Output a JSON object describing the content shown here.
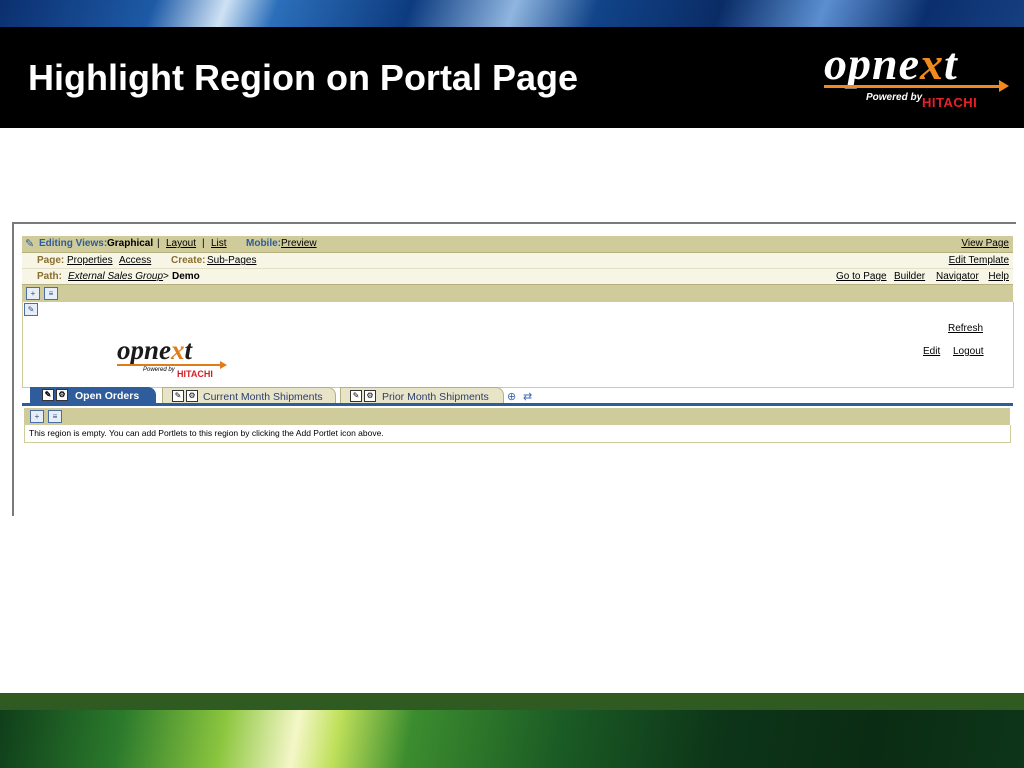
{
  "slide": {
    "title": "Highlight Region on Portal Page",
    "logo": {
      "word_a": "opne",
      "word_x": "x",
      "word_b": "t",
      "powered_by": "Powered by",
      "brand": "HITACHI"
    }
  },
  "portal": {
    "editing_views": {
      "label": "Editing Views:",
      "current": "Graphical",
      "layout": "Layout",
      "list": "List"
    },
    "mobile": {
      "label": "Mobile:",
      "preview": "Preview"
    },
    "view_page": "View Page",
    "page": {
      "label": "Page:",
      "properties": "Properties",
      "access": "Access"
    },
    "create": {
      "label": "Create:",
      "sub_pages": "Sub-Pages"
    },
    "edit_template": "Edit Template",
    "path": {
      "label": "Path:",
      "group": "External Sales Group",
      "separator": ">",
      "current": "Demo"
    },
    "right_links": {
      "go_to_page": "Go to Page",
      "builder": "Builder",
      "navigator": "Navigator",
      "help": "Help"
    },
    "banner": {
      "refresh": "Refresh",
      "edit": "Edit",
      "logout": "Logout"
    },
    "banner_logo": {
      "word_a": "opne",
      "word_x": "x",
      "word_b": "t",
      "powered_by": "Powered by",
      "brand": "HITACHI"
    },
    "tabs": [
      {
        "label": "Open Orders",
        "active": true
      },
      {
        "label": "Current Month Shipments",
        "active": false
      },
      {
        "label": "Prior Month Shipments",
        "active": false
      }
    ],
    "region_message": "This region is empty. You can add Portlets to this region by clicking the Add Portlet icon above."
  },
  "colors": {
    "accent_blue": "#2f5c9a",
    "toolbar_tan": "#cfcb9a",
    "brand_orange": "#f08a1c",
    "brand_red": "#e8202a"
  }
}
